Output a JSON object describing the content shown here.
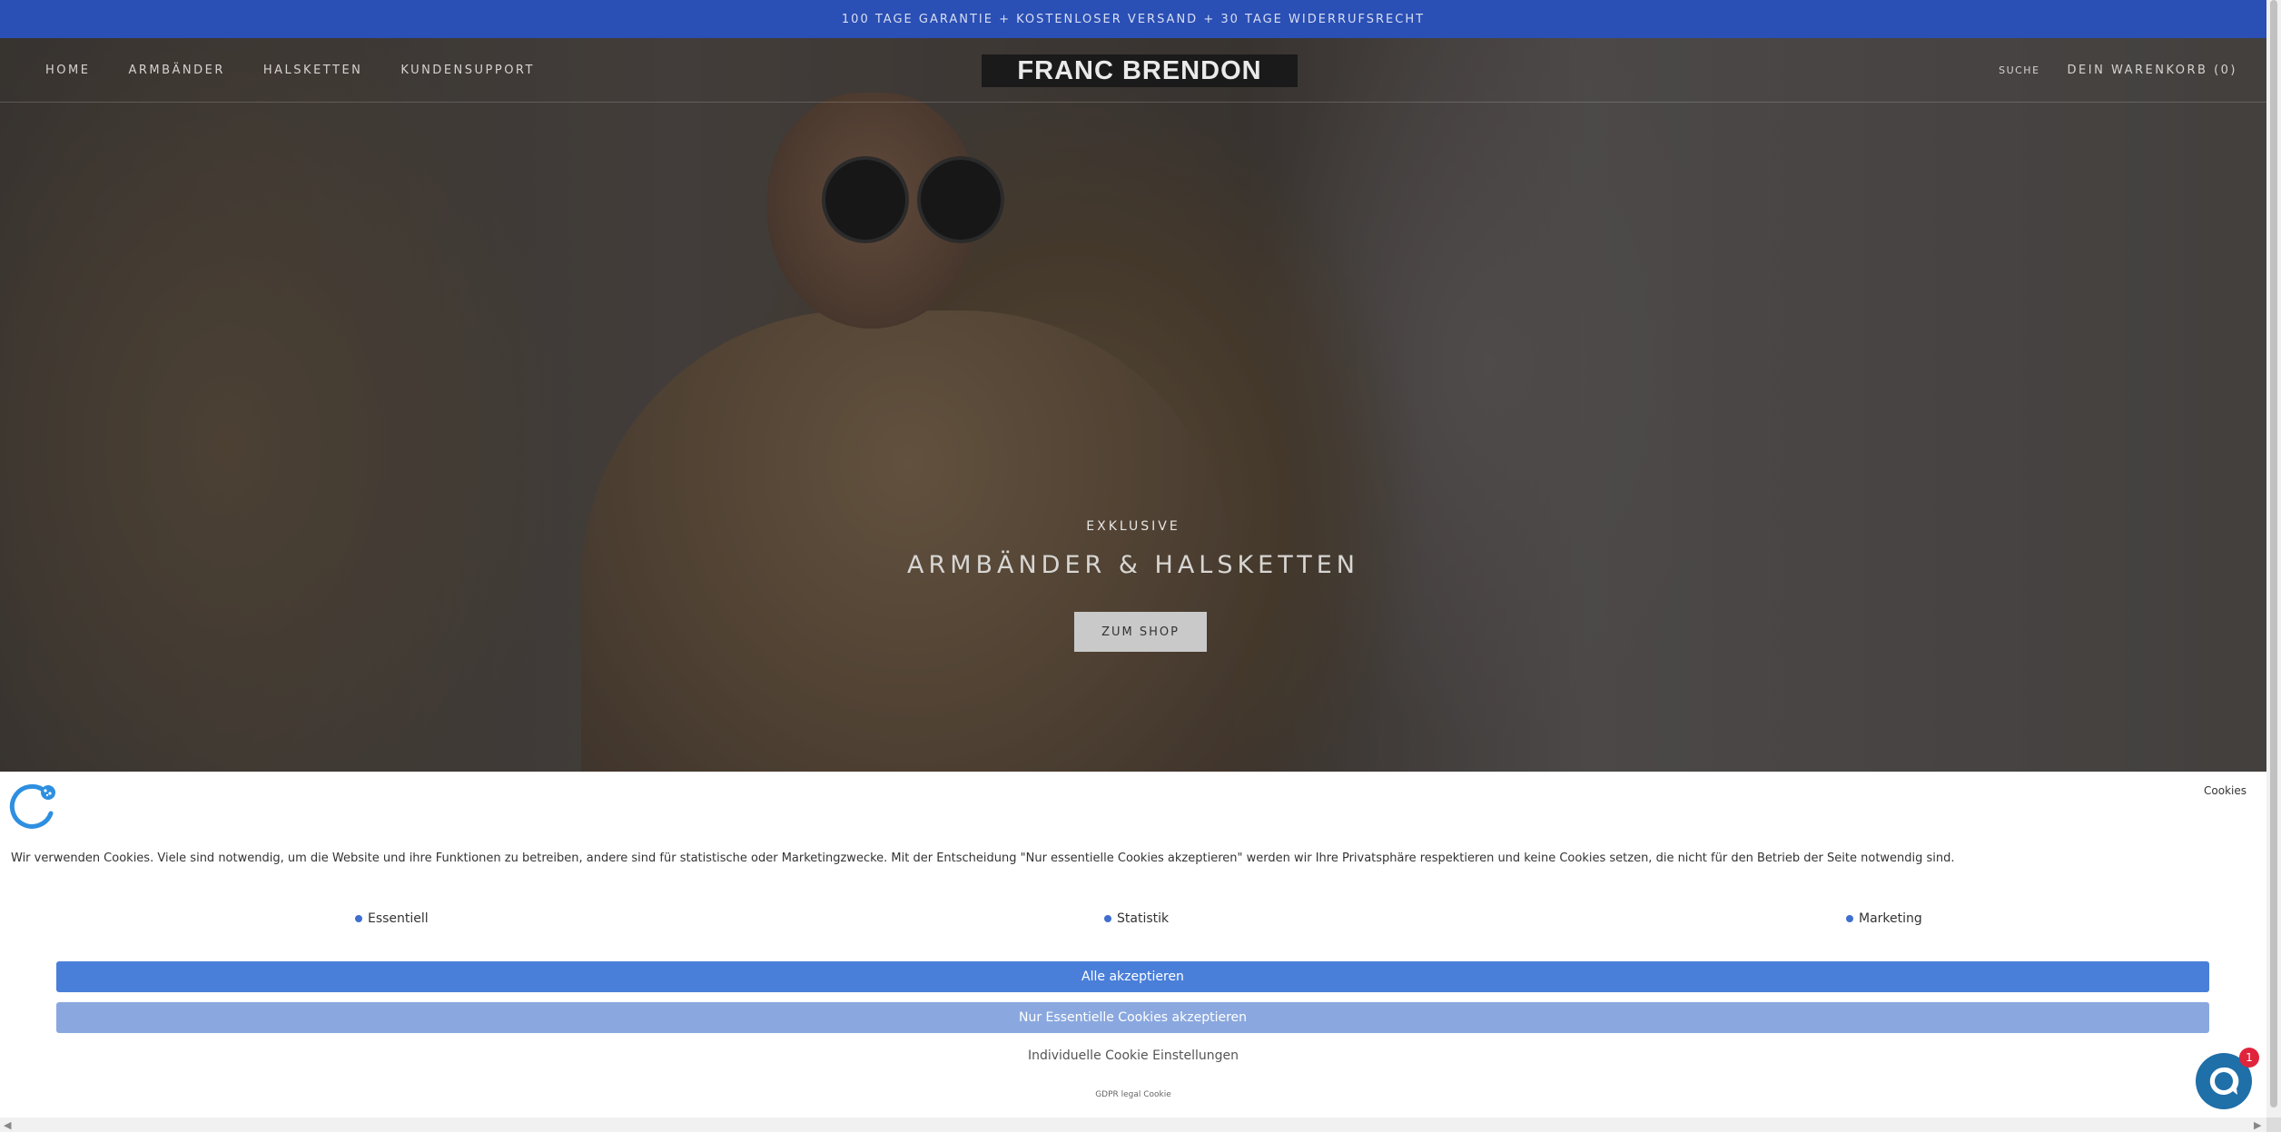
{
  "announcement": "100 TAGE GARANTIE + KOSTENLOSER VERSAND + 30 TAGE WIDERRUFSRECHT",
  "nav": {
    "items": [
      "HOME",
      "ARMBÄNDER",
      "HALSKETTEN",
      "KUNDENSUPPORT"
    ]
  },
  "logo": "FRANC BRENDON",
  "header_right": {
    "search": "SUCHE",
    "cart": "DEIN WARENKORB (0)"
  },
  "hero": {
    "eyebrow": "EXKLUSIVE",
    "title": "ARMBÄNDER & HALSKETTEN",
    "button": "ZUM SHOP"
  },
  "cookie": {
    "title": "Cookies",
    "text": "Wir verwenden Cookies. Viele sind notwendig, um die Website und ihre Funktionen zu betreiben, andere sind für statistische oder Marketingzwecke. Mit der Entscheidung \"Nur essentielle Cookies akzeptieren\" werden wir Ihre Privatsphäre respektieren und keine Cookies setzen, die nicht für den Betrieb der Seite notwendig sind.",
    "categories": [
      "Essentiell",
      "Statistik",
      "Marketing"
    ],
    "accept_all": "Alle akzeptieren",
    "accept_essential": "Nur Essentielle Cookies akzeptieren",
    "individual": "Individuelle Cookie Einstellungen",
    "footer": "GDPR legal Cookie"
  },
  "chat": {
    "badge": "1",
    "icon": "chat-bubble-icon"
  },
  "colors": {
    "announcement_bg": "#2a4fb5",
    "accept_all_bg": "#4a7fd9",
    "accept_essential_bg": "#8aa8df",
    "chat_bg": "#1f6fa8",
    "badge_bg": "#e0243b"
  }
}
